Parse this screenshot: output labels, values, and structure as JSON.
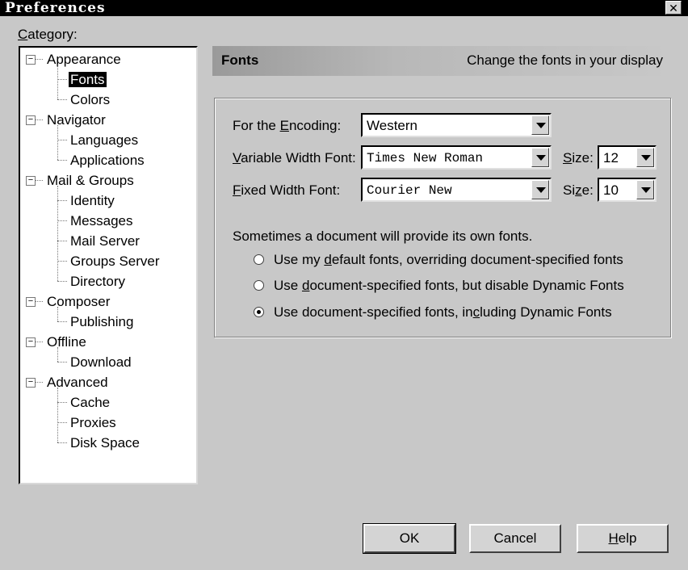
{
  "window": {
    "title": "Preferences",
    "close_glyph": "✕"
  },
  "category": {
    "label_prefix": "C",
    "label_rest": "ategory:",
    "tree": [
      {
        "label": "Appearance",
        "level": 0,
        "expander": "−"
      },
      {
        "label": "Fonts",
        "level": 1,
        "selected": true
      },
      {
        "label": "Colors",
        "level": 1
      },
      {
        "label": "Navigator",
        "level": 0,
        "expander": "−"
      },
      {
        "label": "Languages",
        "level": 1
      },
      {
        "label": "Applications",
        "level": 1
      },
      {
        "label": "Mail & Groups",
        "level": 0,
        "expander": "−"
      },
      {
        "label": "Identity",
        "level": 1
      },
      {
        "label": "Messages",
        "level": 1
      },
      {
        "label": "Mail Server",
        "level": 1
      },
      {
        "label": "Groups Server",
        "level": 1
      },
      {
        "label": "Directory",
        "level": 1
      },
      {
        "label": "Composer",
        "level": 0,
        "expander": "−"
      },
      {
        "label": "Publishing",
        "level": 1
      },
      {
        "label": "Offline",
        "level": 0,
        "expander": "−"
      },
      {
        "label": "Download",
        "level": 1
      },
      {
        "label": "Advanced",
        "level": 0,
        "expander": "−"
      },
      {
        "label": "Cache",
        "level": 1
      },
      {
        "label": "Proxies",
        "level": 1
      },
      {
        "label": "Disk Space",
        "level": 1
      }
    ]
  },
  "panel": {
    "title": "Fonts",
    "description": "Change the fonts in your display",
    "encoding": {
      "pre": "For the ",
      "ul": "E",
      "post": "ncoding:",
      "value": "Western"
    },
    "variable": {
      "ul": "V",
      "post": "ariable Width Font:",
      "value": "Times New Roman",
      "size_ul": "S",
      "size_post": "ize:",
      "size_value": "12"
    },
    "fixed": {
      "ul": "F",
      "post": "ixed Width Font:",
      "value": "Courier New",
      "size_pre": "Si",
      "size_ul": "z",
      "size_post": "e:",
      "size_value": "10"
    },
    "note": "Sometimes a document will provide its own fonts.",
    "radios": [
      {
        "pre": "Use my ",
        "ul": "d",
        "post": "efault fonts, overriding document-specified fonts",
        "checked": false
      },
      {
        "pre": "Use ",
        "ul": "d",
        "post": "ocument-specified fonts, but disable Dynamic Fonts",
        "checked": false
      },
      {
        "pre": "Use document-specified fonts, in",
        "ul": "c",
        "post": "luding Dynamic Fonts",
        "checked": true
      }
    ]
  },
  "buttons": {
    "ok": "OK",
    "cancel": "Cancel",
    "help_ul": "H",
    "help_rest": "elp"
  }
}
